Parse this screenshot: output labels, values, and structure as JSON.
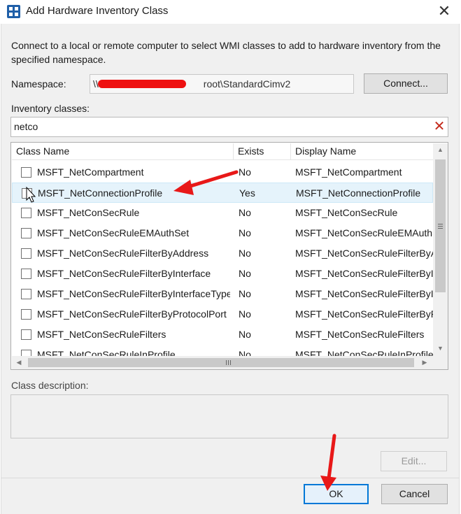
{
  "window": {
    "title": "Add Hardware Inventory Class",
    "close_glyph": "✕"
  },
  "intro_text": "Connect to a local or remote computer to select WMI classes to add to hardware inventory from the specified namespace.",
  "namespace": {
    "label": "Namespace:",
    "value_prefix": "\\\\",
    "value_suffix": "root\\StandardCimv2",
    "connect_button": "Connect..."
  },
  "inventory": {
    "label": "Inventory classes:",
    "search_value": "netco",
    "clear_glyph": "✕"
  },
  "table": {
    "columns": [
      "Class Name",
      "Exists",
      "Display Name"
    ],
    "rows": [
      {
        "name": "MSFT_NetCompartment",
        "exists": "No",
        "display": "MSFT_NetCompartment",
        "checked": false
      },
      {
        "name": "MSFT_NetConnectionProfile",
        "exists": "Yes",
        "display": "MSFT_NetConnectionProfile",
        "checked": false
      },
      {
        "name": "MSFT_NetConSecRule",
        "exists": "No",
        "display": "MSFT_NetConSecRule",
        "checked": false
      },
      {
        "name": "MSFT_NetConSecRuleEMAuthSet",
        "exists": "No",
        "display": "MSFT_NetConSecRuleEMAuthSet",
        "checked": false
      },
      {
        "name": "MSFT_NetConSecRuleFilterByAddress",
        "exists": "No",
        "display": "MSFT_NetConSecRuleFilterByAddress",
        "checked": false
      },
      {
        "name": "MSFT_NetConSecRuleFilterByInterface",
        "exists": "No",
        "display": "MSFT_NetConSecRuleFilterByInterface",
        "checked": false
      },
      {
        "name": "MSFT_NetConSecRuleFilterByInterfaceType",
        "exists": "No",
        "display": "MSFT_NetConSecRuleFilterByInterfaceType",
        "checked": false
      },
      {
        "name": "MSFT_NetConSecRuleFilterByProtocolPort",
        "exists": "No",
        "display": "MSFT_NetConSecRuleFilterByProtocolPort",
        "checked": false
      },
      {
        "name": "MSFT_NetConSecRuleFilters",
        "exists": "No",
        "display": "MSFT_NetConSecRuleFilters",
        "checked": false
      },
      {
        "name": "MSFT_NetConSecRuleInProfile",
        "exists": "No",
        "display": "MSFT_NetConSecRuleInProfile",
        "checked": false
      }
    ]
  },
  "class_description": {
    "label": "Class description:",
    "value": ""
  },
  "buttons": {
    "edit": "Edit...",
    "ok": "OK",
    "cancel": "Cancel"
  },
  "colors": {
    "accent": "#0078d7",
    "annotation_arrow": "#e81818",
    "redaction": "#ee1111",
    "selected_row": "#e5f3fb"
  },
  "icons": {
    "app": "hardware-inventory-icon",
    "clear": "clear-filter-icon",
    "cursor": "mouse-pointer-icon"
  }
}
